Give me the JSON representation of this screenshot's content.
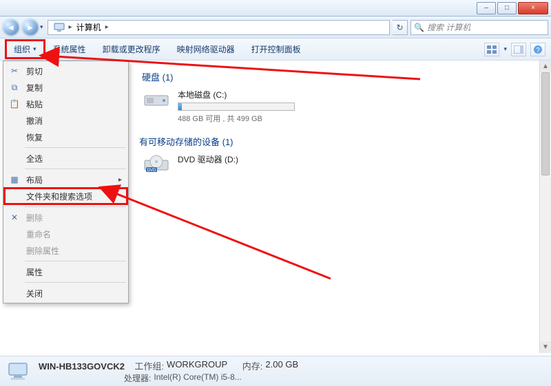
{
  "titlebar": {
    "min": "–",
    "max": "□",
    "close": "×"
  },
  "nav": {
    "location_label": "计算机",
    "chevron": "▸",
    "chevron2": "▸",
    "refresh": "↻",
    "history_caret": "▾"
  },
  "search": {
    "placeholder": "搜索 计算机",
    "icon": "🔍"
  },
  "toolbar": {
    "organize": "组织",
    "organize_caret": "▾",
    "sys_props": "系统属性",
    "uninstall": "卸载或更改程序",
    "map_drive": "映射网络驱动器",
    "control_panel": "打开控制面板",
    "view_caret": "▾"
  },
  "menu": {
    "cut": "剪切",
    "copy": "复制",
    "paste": "粘贴",
    "undo": "撤消",
    "redo": "恢复",
    "select_all": "全选",
    "layout": "布局",
    "layout_arrow": "▸",
    "folder_search_options": "文件夹和搜索选项",
    "delete": "删除",
    "rename": "重命名",
    "remove_props": "删除属性",
    "properties": "属性",
    "close": "关闭"
  },
  "content": {
    "hdd_section_suffix": "硬盘 (1)",
    "local_disk": "本地磁盘 (C:)",
    "disk_stats": "488 GB 可用 , 共 499 GB",
    "disk_ratio_pct": 3,
    "removable_section": "有可移动存储的设备 (1)",
    "dvd_label": "DVD 驱动器 (D:)",
    "dvd_badge": "DVD"
  },
  "status": {
    "computer_name": "WIN-HB133GOVCK2",
    "workgroup_k": "工作组:",
    "workgroup_v": "WORKGROUP",
    "mem_k": "内存:",
    "mem_v": "2.00 GB",
    "cpu_k": "处理器:",
    "cpu_v": "Intel(R) Core(TM) i5-8..."
  }
}
